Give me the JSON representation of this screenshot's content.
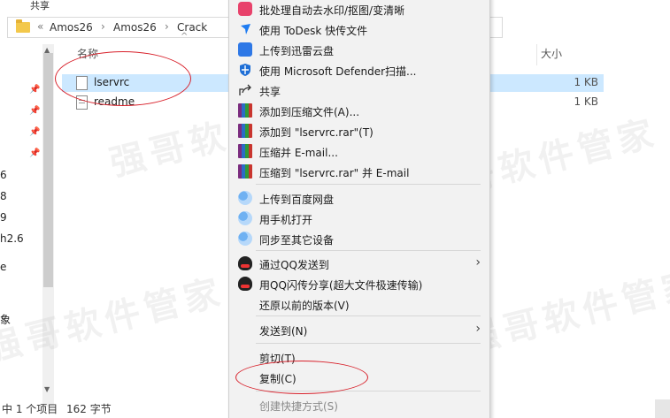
{
  "ribbon": {
    "tab": "共享"
  },
  "address": {
    "prefix": "«",
    "crumbs": [
      "Amos26",
      "Amos26",
      "Crack"
    ]
  },
  "nav": {
    "items": [
      "6",
      "8",
      "9",
      "h2.6",
      "e",
      "象"
    ]
  },
  "file_list": {
    "columns": {
      "name": "名称",
      "size": "大小"
    },
    "rows": [
      {
        "name": "lservrc",
        "size": "1 KB",
        "selected": true
      },
      {
        "name": "readme",
        "size": "1 KB",
        "selected": false
      }
    ]
  },
  "status": {
    "selected": "中 1 个项目",
    "size": "162 字节"
  },
  "watermark": "强哥软件管家",
  "context_menu": {
    "items": [
      {
        "label": "批处理自动去水印/抠图/变清晰",
        "icon": "image-edit-icon"
      },
      {
        "label": "使用 ToDesk 快传文件",
        "icon": "todesk-icon"
      },
      {
        "label": "上传到迅雷云盘",
        "icon": "xunlei-icon"
      },
      {
        "label": "使用 Microsoft Defender扫描...",
        "icon": "defender-shield-icon"
      },
      {
        "label": "共享",
        "icon": "share-icon"
      },
      {
        "label": "添加到压缩文件(A)...",
        "icon": "winrar-icon"
      },
      {
        "label": "添加到 \"lservrc.rar\"(T)",
        "icon": "winrar-icon"
      },
      {
        "label": "压缩并 E-mail...",
        "icon": "winrar-icon"
      },
      {
        "label": "压缩到 \"lservrc.rar\" 并 E-mail",
        "icon": "winrar-icon"
      },
      {
        "label": "上传到百度网盘",
        "icon": "baidu-netdisk-icon"
      },
      {
        "label": "用手机打开",
        "icon": "baidu-netdisk-icon"
      },
      {
        "label": "同步至其它设备",
        "icon": "baidu-netdisk-icon"
      },
      {
        "label": "通过QQ发送到",
        "icon": "qq-icon"
      },
      {
        "label": "用QQ闪传分享(超大文件极速传输)",
        "icon": "qq-icon"
      },
      {
        "label": "还原以前的版本(V)",
        "icon": ""
      },
      {
        "label": "发送到(N)",
        "icon": ""
      },
      {
        "label": "剪切(T)",
        "icon": ""
      },
      {
        "label": "复制(C)",
        "icon": ""
      },
      {
        "label": "创建快捷方式(S)",
        "icon": ""
      }
    ],
    "submenu_glyph": "›"
  },
  "colors": {
    "selection": "#cce8ff",
    "annotation": "#d8202a",
    "menu_bg": "#f2f2f2"
  }
}
